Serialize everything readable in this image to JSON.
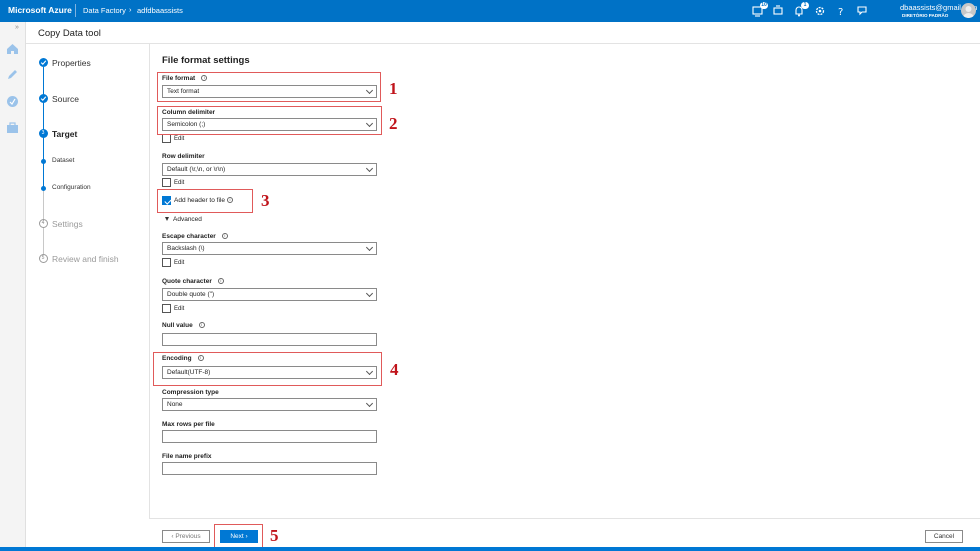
{
  "topbar": {
    "brand": "Microsoft Azure",
    "breadcrumb": [
      "Data Factory",
      "adfdbaassists"
    ],
    "breadcrumb_sep": "›",
    "notifications_count": "10",
    "alerts_count": "1",
    "user_email": "dbaassists@gmail.com",
    "user_directory": "DIRETÓRIO PADRÃO",
    "icons": [
      "cloud-shell-icon",
      "notifications-icon",
      "bell-icon",
      "settings-icon",
      "help-icon",
      "feedback-icon"
    ]
  },
  "header": {
    "title": "Copy Data tool"
  },
  "wizard": {
    "steps": [
      {
        "label": "Properties",
        "state": "done"
      },
      {
        "label": "Source",
        "state": "done"
      },
      {
        "label": "Target",
        "state": "active",
        "number": "3"
      },
      {
        "label": "Dataset",
        "state": "substep"
      },
      {
        "label": "Configuration",
        "state": "substep"
      },
      {
        "label": "Settings",
        "state": "pending",
        "number": "4"
      },
      {
        "label": "Review and finish",
        "state": "pending",
        "number": "5"
      }
    ]
  },
  "form": {
    "title": "File format settings",
    "file_format": {
      "label": "File format",
      "value": "Text format"
    },
    "column_delimiter": {
      "label": "Column delimiter",
      "value": "Semicolon (;)",
      "edit_label": "Edit"
    },
    "row_delimiter": {
      "label": "Row delimiter",
      "value": "Default (\\r,\\n, or \\r\\n)",
      "edit_label": "Edit"
    },
    "add_header": {
      "label": "Add header to file",
      "checked": true
    },
    "advanced_label": "Advanced",
    "escape_character": {
      "label": "Escape character",
      "value": "Backslash (\\)",
      "edit_label": "Edit"
    },
    "quote_character": {
      "label": "Quote character",
      "value": "Double quote (\")",
      "edit_label": "Edit"
    },
    "null_value": {
      "label": "Null value",
      "value": ""
    },
    "encoding": {
      "label": "Encoding",
      "value": "Default(UTF-8)"
    },
    "compression_type": {
      "label": "Compression type",
      "value": "None"
    },
    "max_rows_per_file": {
      "label": "Max rows per file",
      "value": ""
    },
    "file_name_prefix": {
      "label": "File name prefix",
      "value": ""
    }
  },
  "annotations": [
    "1",
    "2",
    "3",
    "4",
    "5"
  ],
  "footer": {
    "previous": "‹ Previous",
    "next": "Next ›",
    "cancel": "Cancel"
  },
  "colors": {
    "brand_blue": "#0072c6",
    "accent": "#0078d4",
    "annotation_red": "#c0141b"
  }
}
